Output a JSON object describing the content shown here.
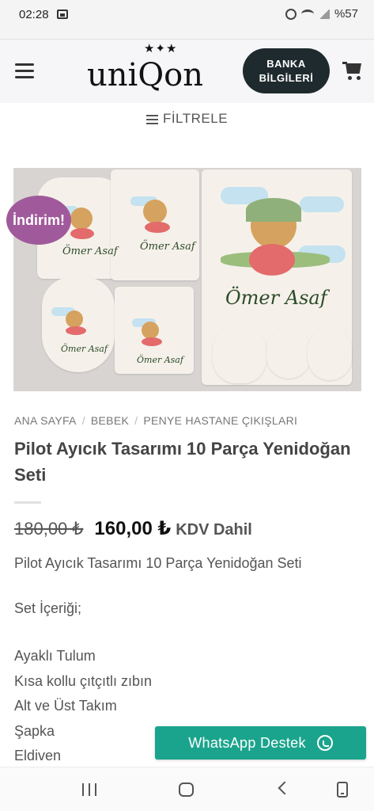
{
  "status_bar": {
    "time": "02:28",
    "battery": "%57"
  },
  "header": {
    "logo": "uniQon",
    "bank_button": "BANKA BİLGİLERİ"
  },
  "filter": {
    "label": "FİLTRELE"
  },
  "product_image": {
    "sale_badge": "İndirim!",
    "printed_name": "Ömer Asaf"
  },
  "breadcrumb": [
    "ANA SAYFA",
    "BEBEK",
    "PENYE HASTANE ÇIKIŞLARI"
  ],
  "product": {
    "title": "Pilot Ayıcık Tasarımı 10 Parça Yenidoğan Seti",
    "old_price": "180,00 ₺",
    "new_price": "160,00 ₺",
    "tax_note": "KDV Dahil",
    "description": "Pilot Ayıcık Tasarımı 10 Parça Yenidoğan Seti",
    "contents_heading": "Set İçeriği;",
    "contents": [
      "Ayaklı Tulum",
      "Kısa kollu çıtçıtlı zıbın",
      "Alt ve Üst Takım",
      "Şapka",
      "Eldiven"
    ]
  },
  "whatsapp": {
    "label": "WhatsApp Destek"
  },
  "icons": [
    "menu-icon",
    "cart-icon",
    "filter-icon",
    "whatsapp-icon",
    "nav-recent-icon",
    "nav-home-icon",
    "nav-back-icon",
    "nav-keyboard-icon"
  ],
  "colors": {
    "accent_green": "#1ba48d",
    "badge_purple": "#a05a9b",
    "button_dark": "#1f2a2e"
  }
}
